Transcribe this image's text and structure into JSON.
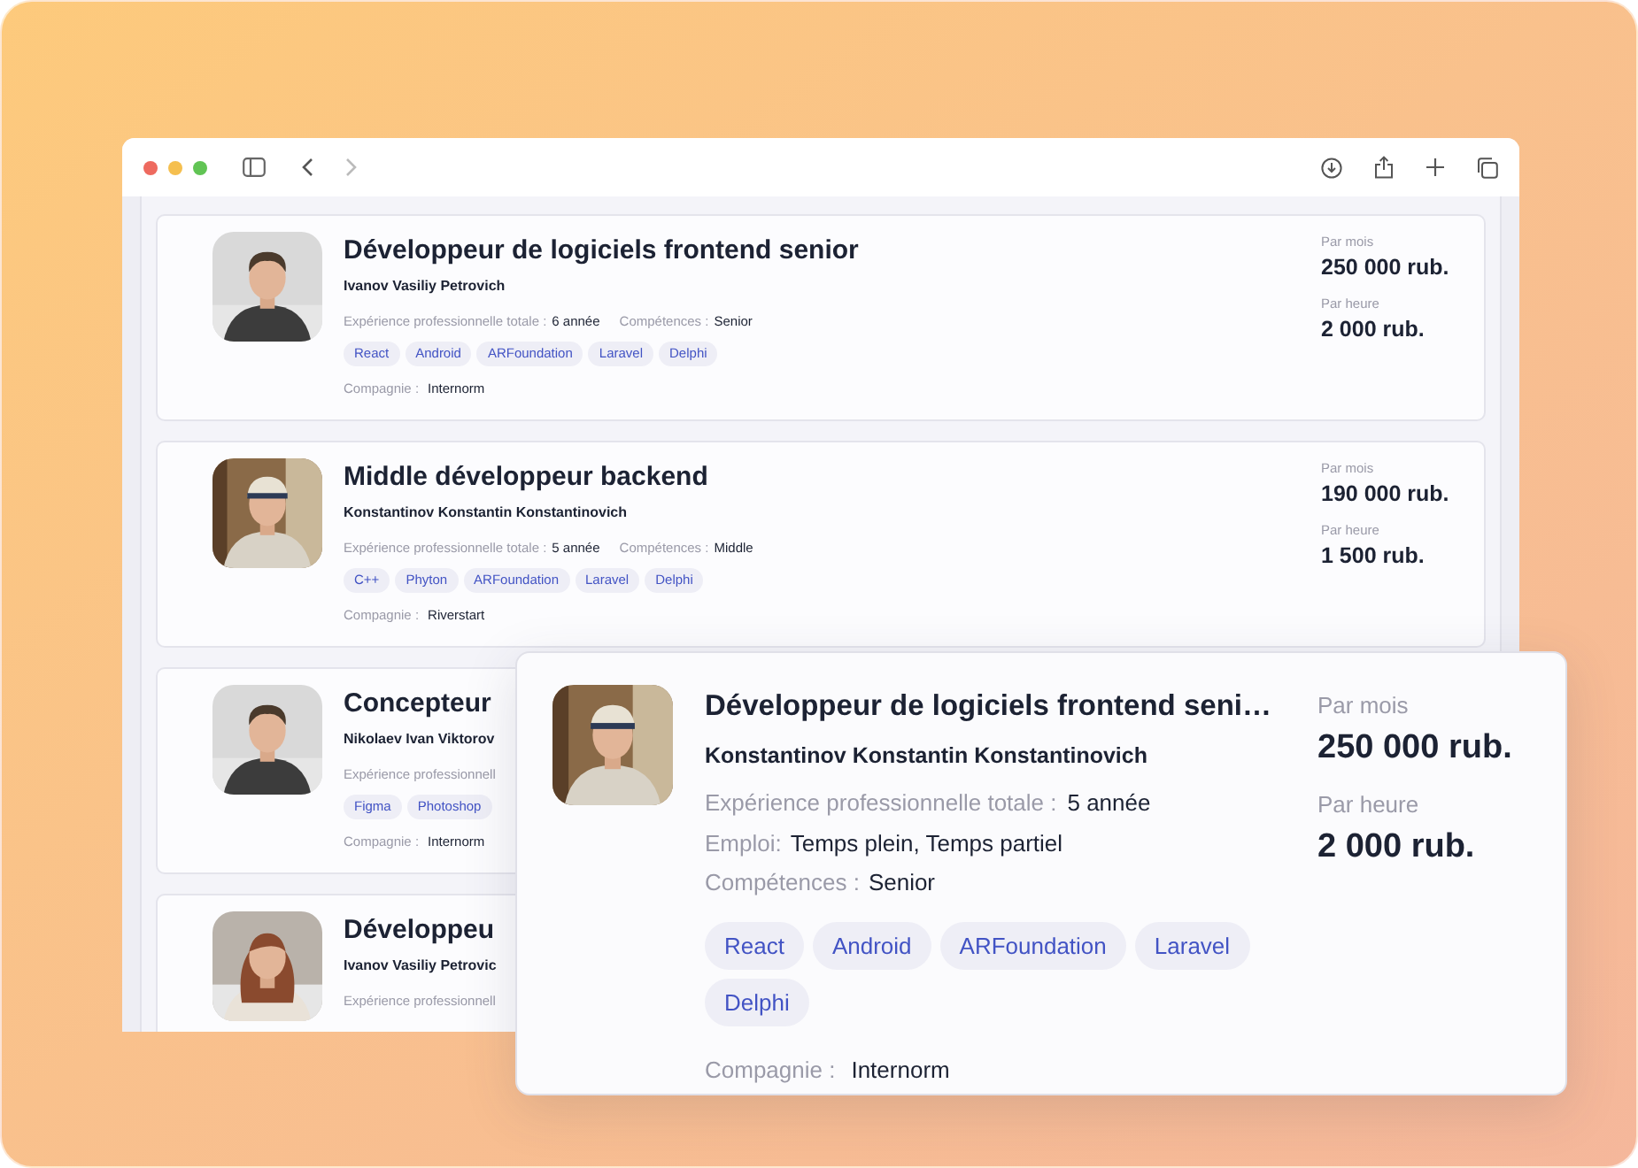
{
  "cards": [
    {
      "title": "Développeur de logiciels frontend senior",
      "name": "Ivanov Vasiliy Petrovich",
      "experience_label": "Expérience professionnelle totale :",
      "experience": "6 année",
      "skills_label": "Compétences :",
      "skills": "Senior",
      "tags": [
        "React",
        "Android",
        "ARFoundation",
        "Laravel",
        "Delphi"
      ],
      "company_label": "Compagnie :",
      "company": "Internorm",
      "month_label": "Par mois",
      "month": "250 000 rub.",
      "hour_label": "Par heure",
      "hour": "2 000 rub."
    },
    {
      "title": "Middle développeur backend",
      "name": "Konstantinov Konstantin Konstantinovich",
      "experience_label": "Expérience professionnelle totale :",
      "experience": "5 année",
      "skills_label": "Compétences :",
      "skills": "Middle",
      "tags": [
        "C++",
        "Phyton",
        "ARFoundation",
        "Laravel",
        "Delphi"
      ],
      "company_label": "Compagnie :",
      "company": "Riverstart",
      "month_label": "Par mois",
      "month": "190 000 rub.",
      "hour_label": "Par heure",
      "hour": "1 500 rub."
    },
    {
      "title": "Concepteur",
      "name": "Nikolaev Ivan Viktorov",
      "experience_label": "Expérience professionnell",
      "tags": [
        "Figma",
        "Photoshop"
      ],
      "company_label": "Compagnie :",
      "company": "Internorm"
    },
    {
      "title": "Développeu",
      "name": "Ivanov Vasiliy Petrovic",
      "experience_label": "Expérience professionnell"
    }
  ],
  "popup": {
    "title": "Développeur de logiciels frontend seni…",
    "name": "Konstantinov Konstantin Konstantinovich",
    "experience_label": "Expérience professionnelle totale :",
    "experience": "5 année",
    "employment_label": "Emploi:",
    "employment": "Temps plein, Temps partiel",
    "skills_label": "Compétences :",
    "skills": "Senior",
    "tags": [
      "React",
      "Android",
      "ARFoundation",
      "Laravel",
      "Delphi"
    ],
    "company_label": "Compagnie :",
    "company": "Internorm",
    "month_label": "Par mois",
    "month": "250 000 rub.",
    "hour_label": "Par heure",
    "hour": "2 000 rub."
  }
}
